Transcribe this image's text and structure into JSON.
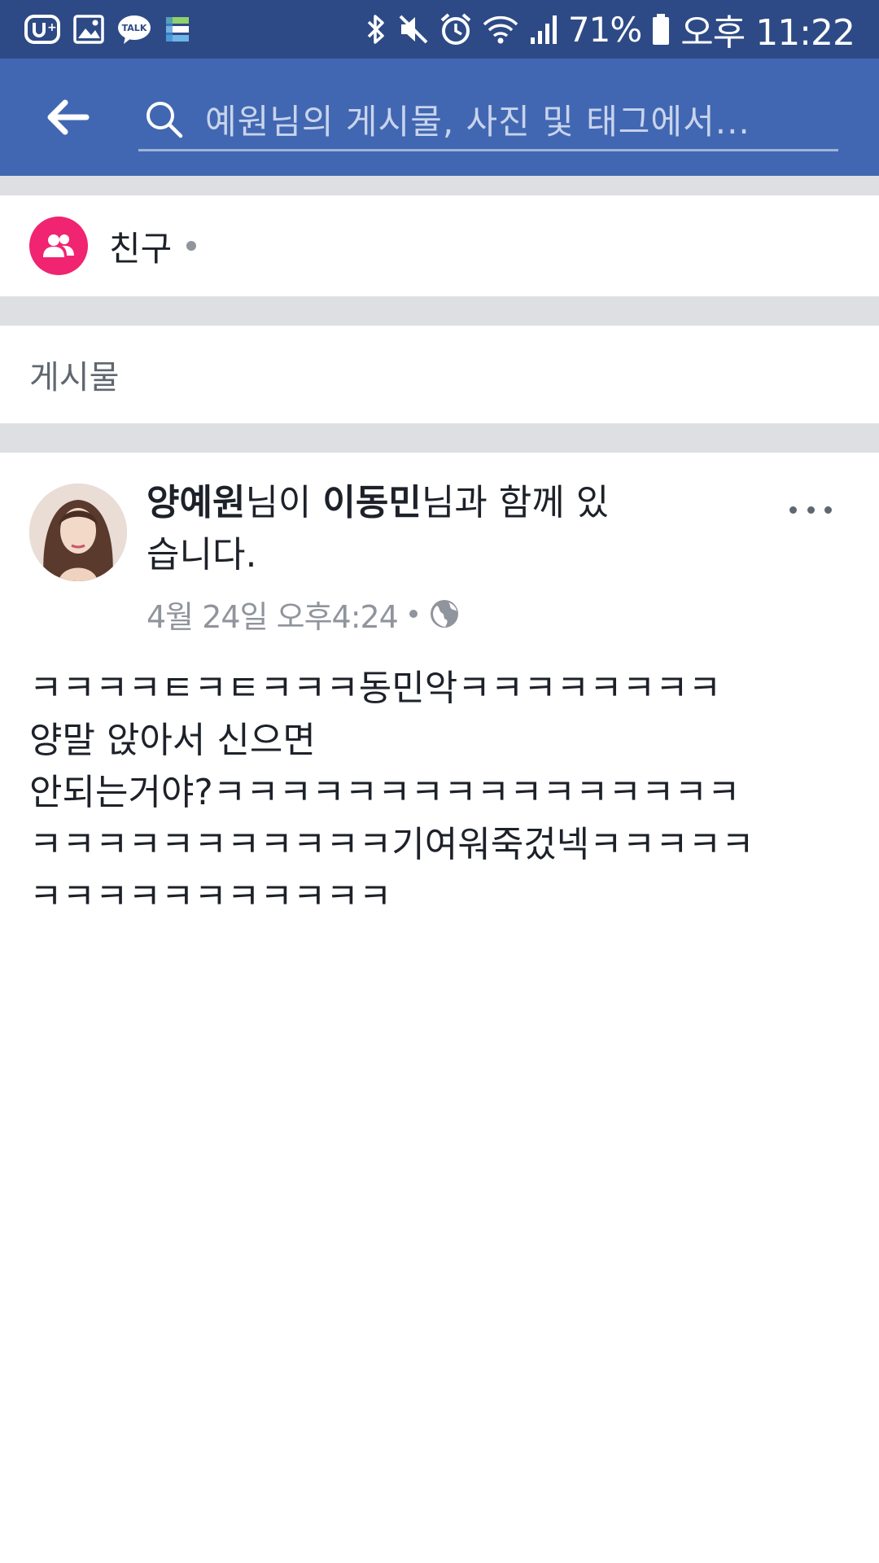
{
  "status_bar": {
    "battery": "71%",
    "time": "오후 11:22",
    "notification_icons": [
      "u-plus-icon",
      "gallery-icon",
      "kakaotalk-icon",
      "stack-app-icon"
    ],
    "system_icons": [
      "bluetooth-icon",
      "mute-icon",
      "alarm-icon",
      "wifi-icon",
      "signal-icon",
      "battery-icon"
    ],
    "talk_label": "TALK"
  },
  "search": {
    "placeholder": "예원님의 게시물, 사진 및 태그에서..."
  },
  "friends": {
    "label": "친구"
  },
  "posts_section": {
    "label": "게시물"
  },
  "post": {
    "author": "양예원",
    "title_mid": "님이 ",
    "tagged": "이동민",
    "title_end": "님과 함께 있습니다.",
    "timestamp": "4월 24일 오후4:24",
    "privacy": "globe-icon",
    "body": "ㅋㅋㅋㅋㅌㅋㅌㅋㅋㅋ동민악ㅋㅋㅋㅋㅋㅋㅋㅋ\n양말 앉아서 신으면\n안되는거야?ㅋㅋㅋㅋㅋㅋㅋㅋㅋㅋㅋㅋㅋㅋㅋㅋ\nㅋㅋㅋㅋㅋㅋㅋㅋㅋㅋㅋ기여워죽겄넥ㅋㅋㅋㅋㅋ\nㅋㅋㅋㅋㅋㅋㅋㅋㅋㅋㅋ"
  },
  "colors": {
    "status_bar": "#2d4a86",
    "header": "#4267b2",
    "friends_badge": "#f02471",
    "divider": "#dddfe2"
  }
}
